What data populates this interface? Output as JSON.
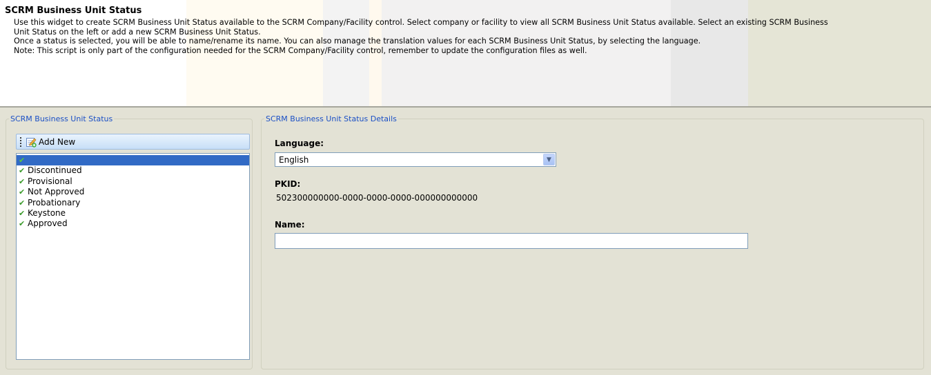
{
  "header": {
    "title": "SCRM Business Unit Status",
    "desc_line1": "Use this widget to create SCRM Business Unit Status available to the SCRM Company/Facility control. Select company or facility to view all SCRM Business Unit Status available. Select an existing SCRM Business",
    "desc_line2": "Unit Status on the left or add a new SCRM Business Unit Status.",
    "desc_line3": "Once a status is selected, you will be able to name/rename its name. You can also manage the translation values for each SCRM Business Unit Status, by selecting the language.",
    "desc_line4": "Note: This script is only part of the configuration needed for the SCRM Company/Facility control, remember to update the configuration files as well."
  },
  "left_panel": {
    "legend": "SCRM Business Unit Status",
    "add_new_label": "Add New",
    "items": [
      {
        "label": "",
        "selected": true
      },
      {
        "label": "Discontinued"
      },
      {
        "label": "Provisional"
      },
      {
        "label": "Not Approved"
      },
      {
        "label": "Probationary"
      },
      {
        "label": "Keystone"
      },
      {
        "label": "Approved"
      }
    ]
  },
  "right_panel": {
    "legend": "SCRM Business Unit Status Details",
    "language_label": "Language:",
    "language_value": "English",
    "pkid_label": "PKID:",
    "pkid_value": "502300000000-0000-0000-0000-000000000000",
    "name_label": "Name:",
    "name_value": ""
  },
  "icons": {
    "add": "add-new-icon",
    "check": "check-icon",
    "dropdown": "chevron-down-icon"
  },
  "colors": {
    "legend": "#1a4fc5",
    "selection": "#316ac5",
    "check": "#3a9a2a",
    "panel_bg": "#e3e2d5"
  }
}
